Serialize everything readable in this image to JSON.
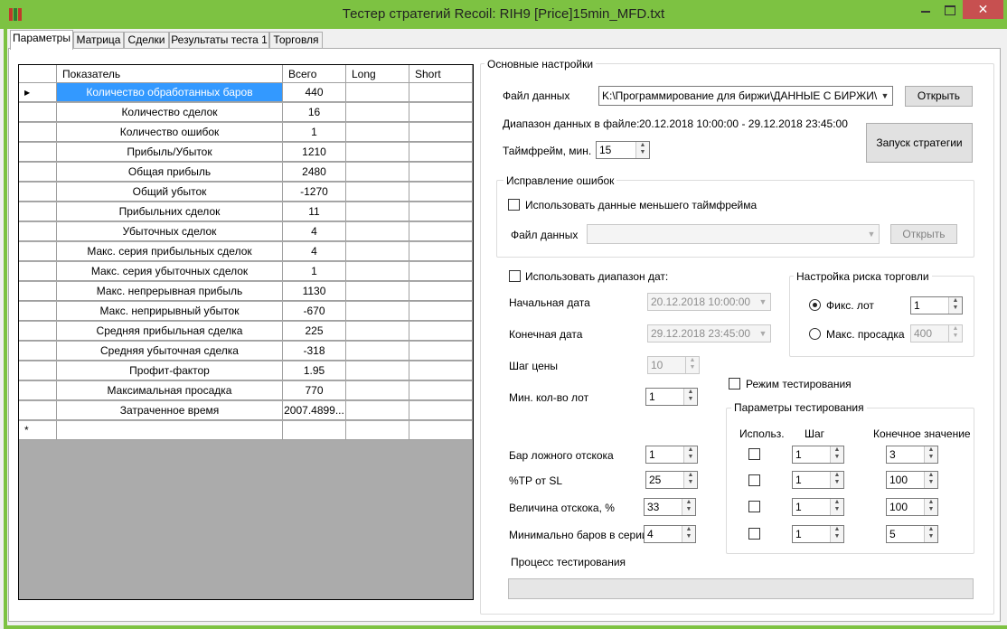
{
  "window": {
    "title": "Тестер стратегий Recoil: RIH9 [Price]15min_MFD.txt",
    "close_glyph": "✕",
    "accent": "#7dc242",
    "close_color": "#c75050"
  },
  "tabs": [
    {
      "label": "Параметры"
    },
    {
      "label": "Матрица"
    },
    {
      "label": "Сделки"
    },
    {
      "label": "Результаты теста 1"
    },
    {
      "label": "Торговля"
    }
  ],
  "grid": {
    "columns": [
      "Показатель",
      "Всего",
      "Long",
      "Short"
    ],
    "rows": [
      {
        "name": "Количество обработанных баров",
        "total": "440"
      },
      {
        "name": "Количество сделок",
        "total": "16"
      },
      {
        "name": "Количество ошибок",
        "total": "1"
      },
      {
        "name": "Прибыль/Убыток",
        "total": "1210"
      },
      {
        "name": "Общая прибыль",
        "total": "2480"
      },
      {
        "name": "Общий убыток",
        "total": "-1270"
      },
      {
        "name": "Прибыльних сделок",
        "total": "11"
      },
      {
        "name": "Убыточных сделок",
        "total": "4"
      },
      {
        "name": "Макс. серия прибыльных сделок",
        "total": "4"
      },
      {
        "name": "Макс. серия убыточных сделок",
        "total": "1"
      },
      {
        "name": "Макс. непрерывная прибыль",
        "total": "1130"
      },
      {
        "name": "Макс. неприрывный убыток",
        "total": "-670"
      },
      {
        "name": "Средняя прибыльная сделка",
        "total": "225"
      },
      {
        "name": "Средняя убыточная сделка",
        "total": "-318"
      },
      {
        "name": "Профит-фактор",
        "total": "1.95"
      },
      {
        "name": "Максимальная просадка",
        "total": "770"
      },
      {
        "name": "Затраченное время",
        "total": "2007.4899..."
      }
    ],
    "current_row_marker": "▶",
    "new_row_marker": "*"
  },
  "main": {
    "group_label": "Основные настройки",
    "data_file_label": "Файл данных",
    "data_file_value": "K:\\Программирование для биржи\\ДАННЫЕ С БИРЖИ\\RIH",
    "open_button": "Открыть",
    "range_label": "Диапазон данных в файле:",
    "range_value": "20.12.2018 10:00:00 - 29.12.2018 23:45:00",
    "timeframe_label": "Таймфрейм, мин.",
    "timeframe_value": "15",
    "run_button": "Запуск стратегии"
  },
  "errors": {
    "group_label": "Исправление ошибок",
    "use_smaller_tf": "Использовать данные меньшего таймфрейма",
    "data_file_label": "Файл данных",
    "open_button": "Открыть"
  },
  "dates": {
    "use_range": "Использовать диапазон дат:",
    "start_label": "Начальная дата",
    "start_value": "20.12.2018 10:00:00",
    "end_label": "Конечная дата",
    "end_value": "29.12.2018 23:45:00",
    "price_step_label": "Шаг цены",
    "price_step_value": "10",
    "min_lots_label": "Мин. кол-во лот",
    "min_lots_value": "1"
  },
  "risk": {
    "group_label": "Настройка риска торговли",
    "fixed_lot_label": "Фикс. лот",
    "fixed_lot_value": "1",
    "max_dd_label": "Макс. просадка",
    "max_dd_value": "400"
  },
  "testing": {
    "mode_label": "Режим тестирования",
    "group_label": "Параметры тестирования",
    "col_use": "Использ.",
    "col_step": "Шаг",
    "col_end": "Конечное значение",
    "params": [
      {
        "label": "Бар ложного отскока",
        "value": "1",
        "step": "1",
        "end": "3"
      },
      {
        "label": "%TP от SL",
        "value": "25",
        "step": "1",
        "end": "100"
      },
      {
        "label": "Величина отскока, %",
        "value": "33",
        "step": "1",
        "end": "100"
      },
      {
        "label": "Минимально баров в серии",
        "value": "4",
        "step": "1",
        "end": "5"
      }
    ],
    "process_label": "Процесс тестирования",
    "progress": 0
  }
}
